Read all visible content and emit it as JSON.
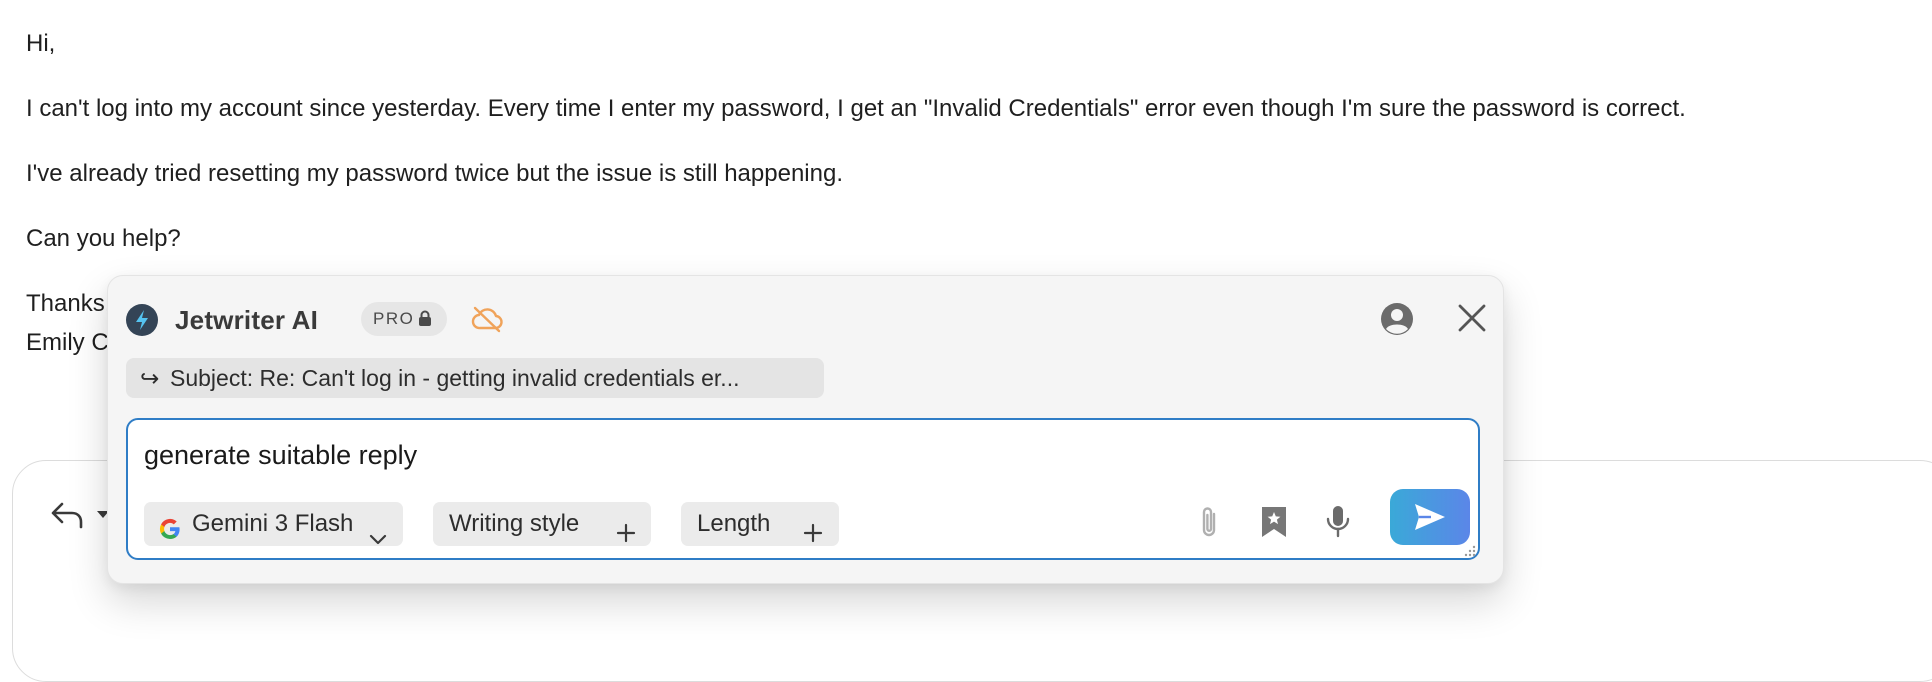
{
  "email": {
    "greeting": "Hi,",
    "paragraph1": "I can't log into my account since yesterday. Every time I enter my password, I get an \"Invalid Credentials\" error even though I'm sure the password is correct.",
    "paragraph2": "I've already tried resetting my password twice but the issue is still happening.",
    "paragraph3": "Can you help?",
    "signoff": "Thanks,",
    "signature": "Emily C"
  },
  "assistant": {
    "brand": "Jetwriter AI",
    "badge": "PRO",
    "subject": "Subject: Re: Can't log in - getting invalid credentials er...",
    "subject_arrow": "↪",
    "prompt": "generate suitable reply",
    "model": "Gemini 3 Flash",
    "writing_style_label": "Writing style",
    "length_label": "Length",
    "colors": {
      "accent_border": "#2f7dc6",
      "send_gradient_start": "#3aa9d8",
      "send_gradient_end": "#5b86e8",
      "cloud_off_icon": "#f0a35a",
      "logo_bolt": "#55c3f0"
    }
  }
}
